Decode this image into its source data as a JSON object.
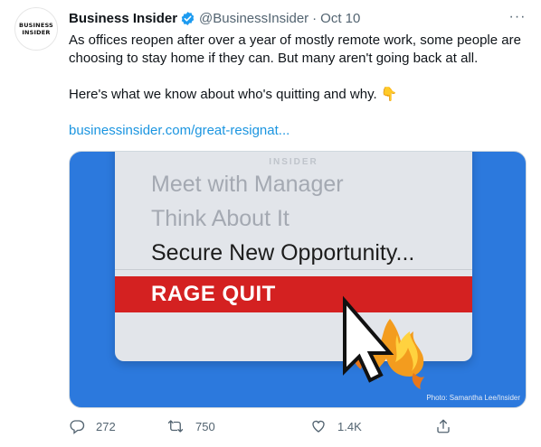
{
  "avatar": {
    "line1": "BUSINESS",
    "line2": "INSIDER"
  },
  "tweet": {
    "author": "Business Insider",
    "handle": "@BusinessInsider",
    "separator": "·",
    "date": "Oct 10",
    "more_label": "···",
    "paragraph1": "As offices reopen after over a year of mostly remote work, some people are choosing to stay home if they can. But many aren't going back at all.",
    "paragraph2": "Here's what we know about who's quitting and why. 👇",
    "link": "businessinsider.com/great-resignat..."
  },
  "media": {
    "brand": "INSIDER",
    "menu_items": [
      "Meet with Manager",
      "Think About It",
      "Secure New Opportunity..."
    ],
    "highlight": "RAGE QUIT",
    "credit": "Photo: Samantha Lee/Insider",
    "colors": {
      "background": "#2c79dd",
      "panel": "#e2e5ea",
      "highlight": "#d42121"
    }
  },
  "actions": {
    "reply_count": "272",
    "retweet_count": "750",
    "like_count": "1.4K"
  },
  "colors": {
    "accent": "#1b95e0",
    "verified": "#1d9bf0",
    "muted": "#536471"
  }
}
